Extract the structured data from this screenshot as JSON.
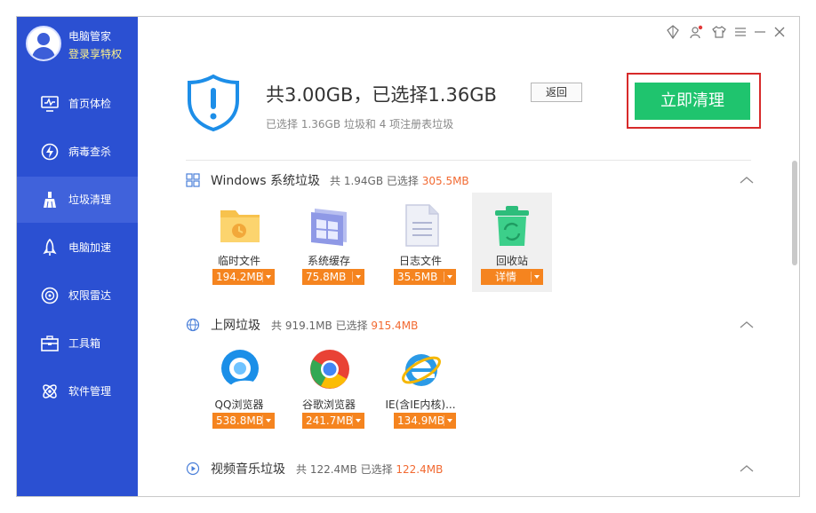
{
  "sidebar": {
    "profile_name": "电脑管家",
    "profile_link": "登录享特权",
    "items": [
      {
        "label": "首页体检",
        "icon": "monitor-icon"
      },
      {
        "label": "病毒查杀",
        "icon": "virus-icon"
      },
      {
        "label": "垃圾清理",
        "icon": "broom-icon",
        "active": true
      },
      {
        "label": "电脑加速",
        "icon": "rocket-icon"
      },
      {
        "label": "权限雷达",
        "icon": "radar-icon"
      },
      {
        "label": "工具箱",
        "icon": "toolbox-icon"
      },
      {
        "label": "软件管理",
        "icon": "software-icon"
      }
    ]
  },
  "topbar": [
    "skin-icon",
    "user-settings-icon",
    "shirt-icon",
    "menu-icon",
    "minimize-icon",
    "close-icon"
  ],
  "header": {
    "title": "共3.00GB，已选择1.36GB",
    "back_label": "返回",
    "subtitle": "已选择 1.36GB 垃圾和 4 项注册表垃圾",
    "clean_label": "立即清理"
  },
  "sections": [
    {
      "title": "Windows 系统垃圾",
      "stats_prefix": "共 1.94GB 已选择",
      "stats_value": "305.5MB",
      "items": [
        {
          "label": "临时文件",
          "size": "194.2MB"
        },
        {
          "label": "系统缓存",
          "size": "75.8MB"
        },
        {
          "label": "日志文件",
          "size": "35.5MB"
        },
        {
          "label": "回收站",
          "size": "详情"
        }
      ]
    },
    {
      "title": "上网垃圾",
      "stats_prefix": "共 919.1MB 已选择",
      "stats_value": "915.4MB",
      "items": [
        {
          "label": "QQ浏览器",
          "size": "538.8MB"
        },
        {
          "label": "谷歌浏览器",
          "size": "241.7MB"
        },
        {
          "label": "IE(含IE内核)...",
          "size": "134.9MB"
        }
      ]
    },
    {
      "title": "视频音乐垃圾",
      "stats_prefix": "共 122.4MB 已选择",
      "stats_value": "122.4MB"
    }
  ],
  "colors": {
    "sidebar": "#2b50d2",
    "accent_orange": "#f5841f",
    "clean_green": "#1fc46e",
    "highlight_red": "#d72a2a"
  }
}
